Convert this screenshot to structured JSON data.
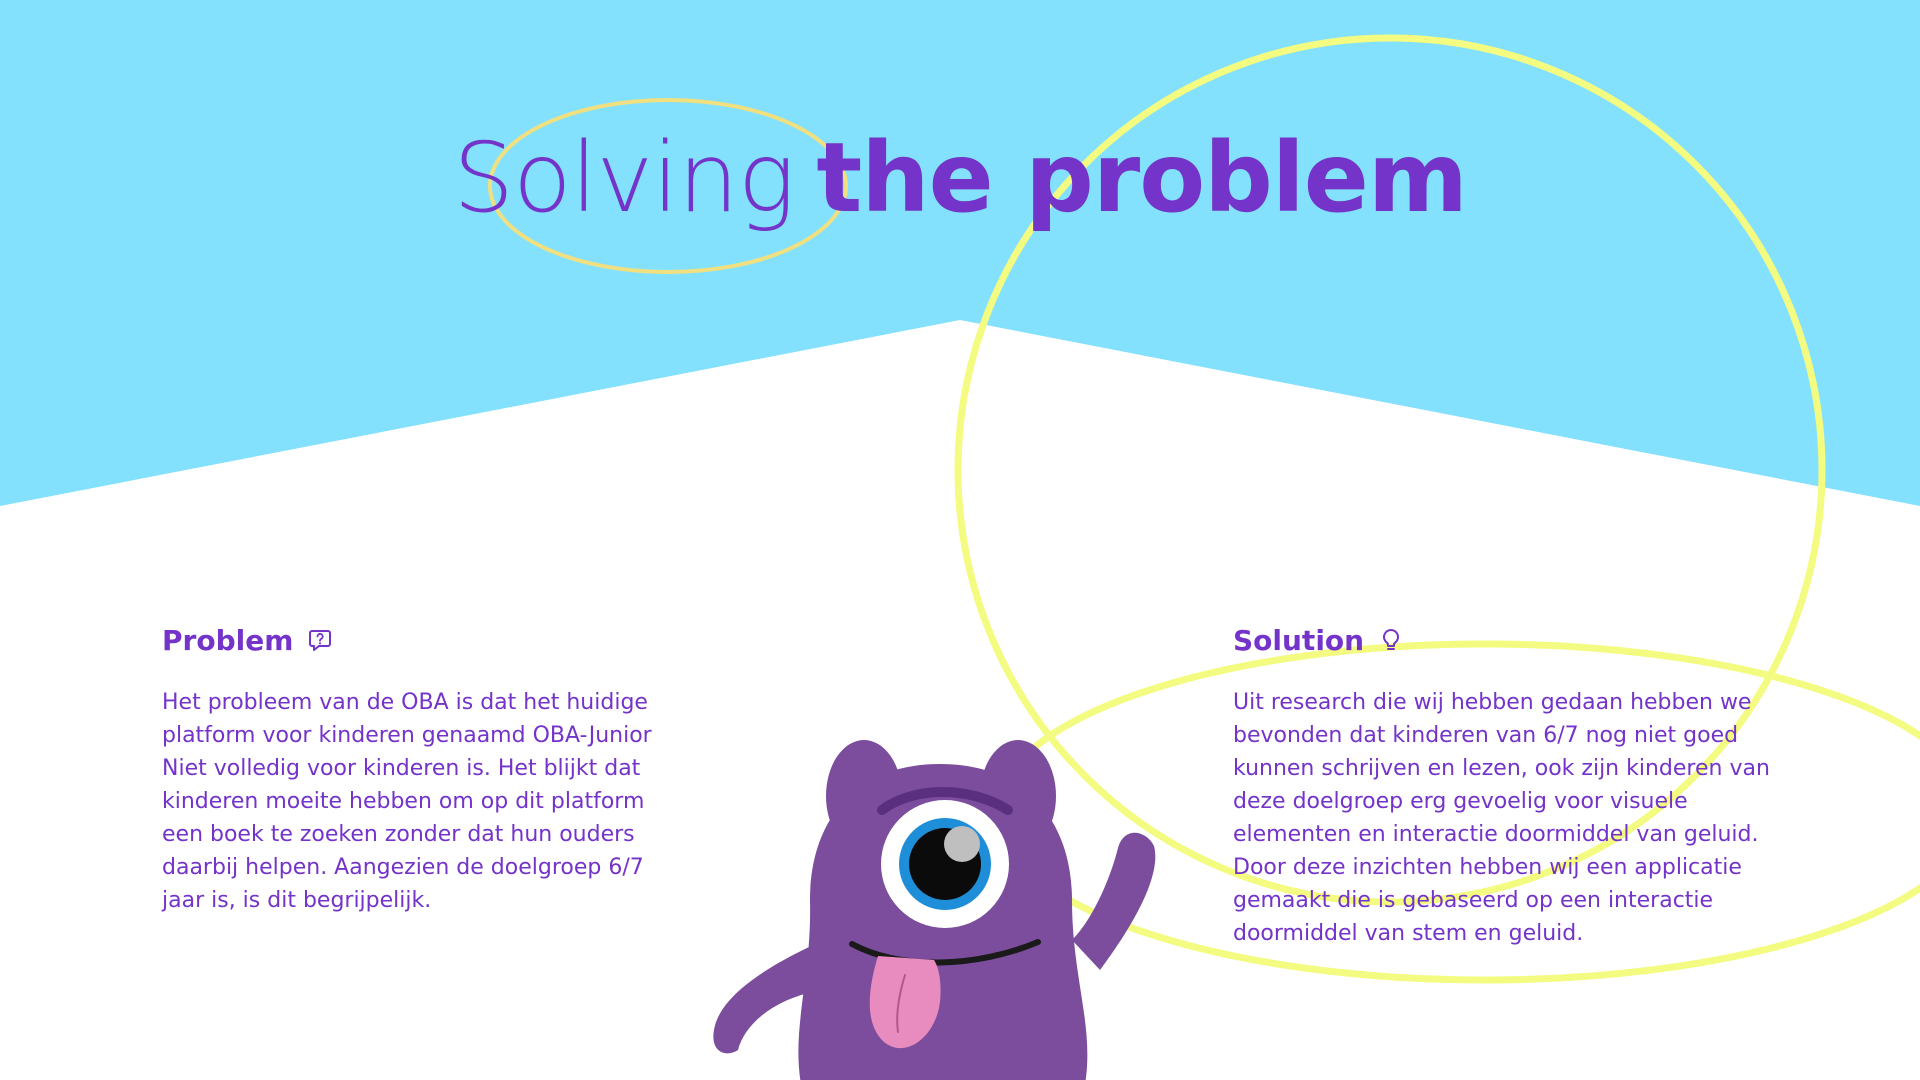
{
  "hero": {
    "title_light": "Solving",
    "title_bold": "the problem"
  },
  "problem": {
    "heading": "Problem",
    "icon": "help-bubble-icon",
    "body": "Het probleem van de OBA is dat het huidige\nplatform voor kinderen genaamd OBA-Junior\nNiet volledig voor kinderen is. Het blijkt dat\nkinderen moeite hebben om op dit platform\neen boek te zoeken zonder dat hun ouders\ndaarbij helpen. Aangezien de doelgroep 6/7\njaar is, is dit begrijpelijk."
  },
  "solution": {
    "heading": "Solution",
    "icon": "lightbulb-icon",
    "body": "Uit research die wij hebben gedaan hebben we\nbevonden dat kinderen van 6/7 nog niet goed\nkunnen schrijven en lezen, ook zijn kinderen van\ndeze doelgroep erg gevoelig voor visuele\nelementen en interactie doormiddel van geluid.\nDoor deze inzichten hebben wij een applicatie\ngemaakt die is gebaseerd op een interactie\ndoormiddel van stem en geluid."
  },
  "colors": {
    "sky": "#84e1fe",
    "purple_text": "#7433c9",
    "accent_yellow": "#f3fb80",
    "title_ring": "#f1e07f",
    "monster": "#7b4d9c",
    "monster_dark": "#5b2f80",
    "iris": "#1f8ed8",
    "tongue": "#e88bbf"
  },
  "mascot": {
    "icon": "purple-monster-illustration"
  }
}
